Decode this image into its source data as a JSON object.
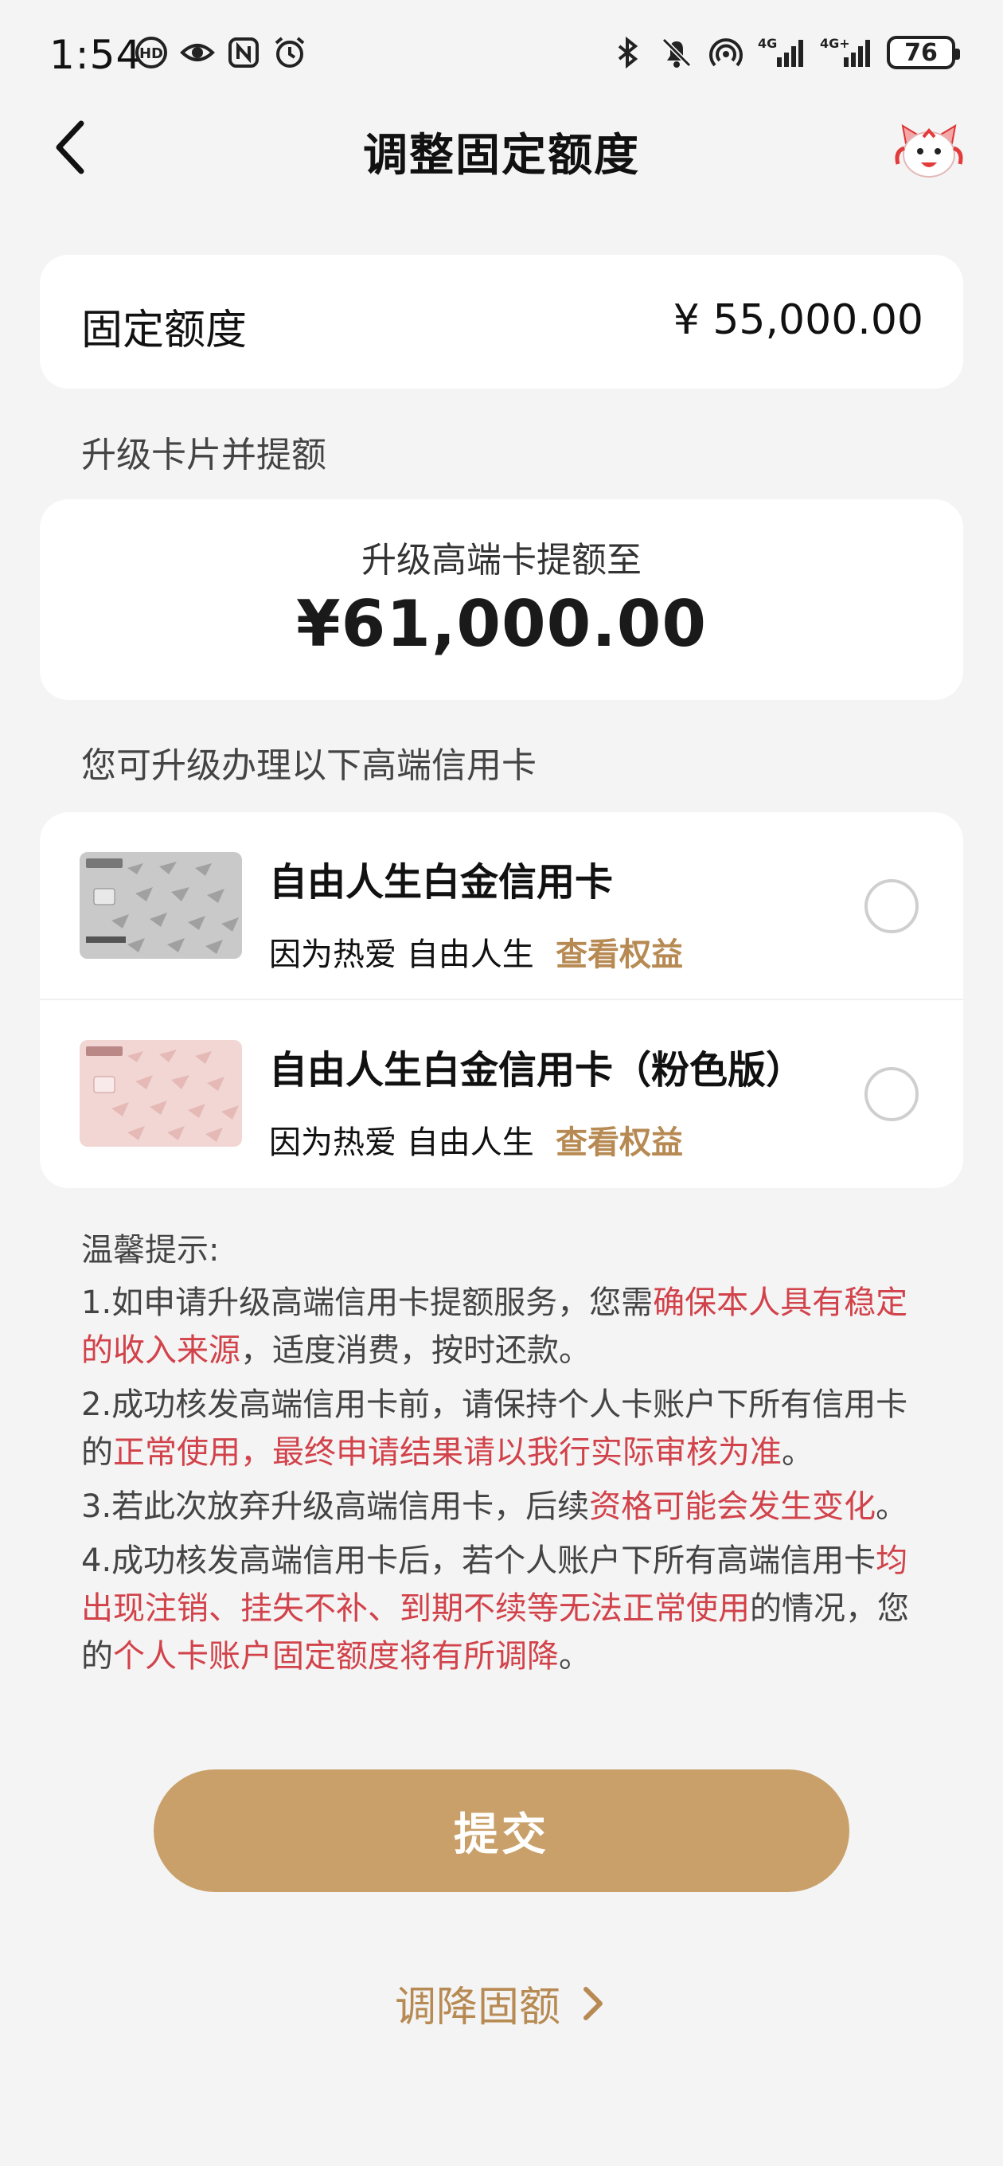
{
  "status_bar": {
    "time": "1:54",
    "battery": "76",
    "icons": [
      "hd-voice-icon",
      "eye-icon",
      "nfc-icon",
      "alarm-icon",
      "bluetooth-icon",
      "mute-icon",
      "hotspot-icon",
      "signal-4g-icon",
      "signal-4g-plus-icon",
      "battery-icon"
    ]
  },
  "header": {
    "title": "调整固定额度",
    "back_icon": "chevron-left-icon",
    "mascot_icon": "mascot-icon"
  },
  "fixed_limit": {
    "label": "固定额度",
    "value": "¥ 55,000.00"
  },
  "upgrade_section": {
    "label": "升级卡片并提额",
    "subtitle": "升级高端卡提额至",
    "amount": "¥61,000.00"
  },
  "cards_section": {
    "label": "您可升级办理以下高端信用卡",
    "items": [
      {
        "name": "自由人生白金信用卡",
        "slogan": "因为热爱 自由人生",
        "link": "查看权益",
        "thumb_color": "silver",
        "selected": false
      },
      {
        "name": "自由人生白金信用卡（粉色版）",
        "slogan": "因为热爱 自由人生",
        "link": "查看权益",
        "thumb_color": "pink",
        "selected": false
      }
    ]
  },
  "tips": {
    "title": "温馨提示:",
    "t1_a": "1.如申请升级高端信用卡提额服务，您需",
    "t1_hl": "确保本人具有稳定的收入来源",
    "t1_b": "，适度消费，按时还款。",
    "t2_a": "2.成功核发高端信用卡前，请保持个人卡账户下所有信用卡的",
    "t2_hl": "正常使用，最终申请结果请以我行实际审核为准",
    "t2_b": "。",
    "t3_a": "3.若此次放弃升级高端信用卡，后续",
    "t3_hl": "资格可能会发生变化",
    "t3_b": "。",
    "t4_a": "4.成功核发高端信用卡后，若个人账户下所有高端信用卡",
    "t4_hl1": "均出现注销、挂失不补、到期不续等无法正常使用",
    "t4_b": "的情况，您的",
    "t4_hl2": "个人卡账户固定额度将有所调降",
    "t4_c": "。"
  },
  "actions": {
    "submit": "提交",
    "reduce": "调降固额"
  },
  "colors": {
    "accent": "#c9a06a",
    "link": "#b78a53",
    "highlight": "#d2424a",
    "background": "#f4f4f4"
  }
}
